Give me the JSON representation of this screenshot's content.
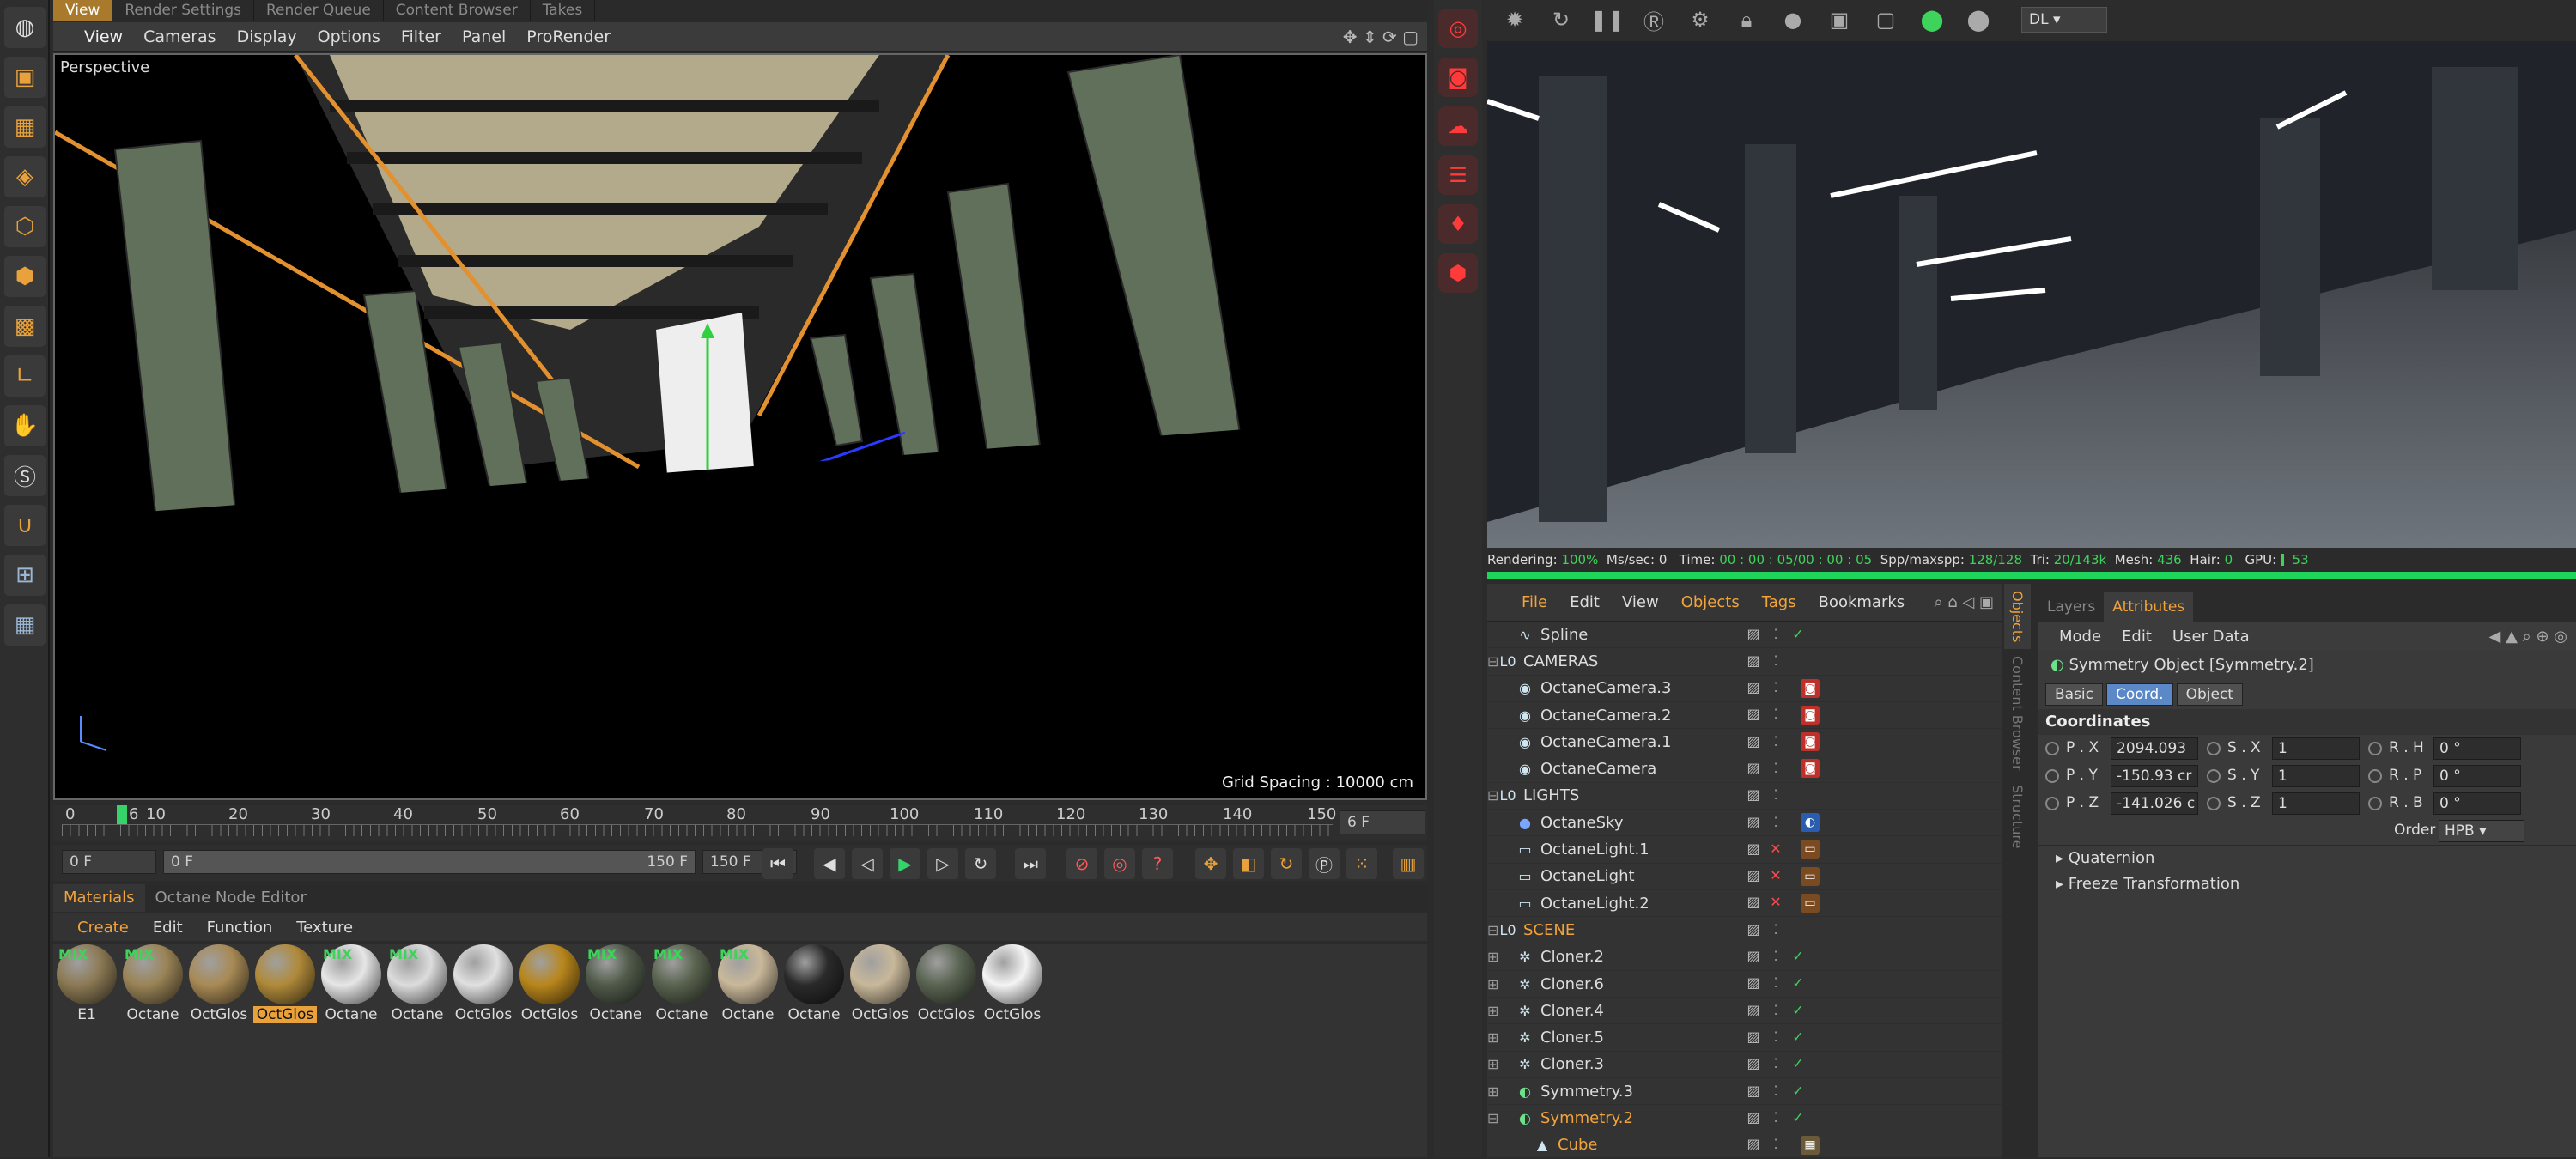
{
  "top_tabs": [
    "View",
    "Render Settings",
    "Render Queue",
    "Content Browser",
    "Takes"
  ],
  "viewport_menu": [
    "View",
    "Cameras",
    "Display",
    "Options",
    "Filter",
    "Panel",
    "ProRender"
  ],
  "viewport": {
    "label": "Perspective",
    "grid_spacing": "Grid Spacing : 10000 cm"
  },
  "timeline": {
    "ticks": [
      "0",
      "6",
      "10",
      "20",
      "30",
      "40",
      "50",
      "60",
      "70",
      "80",
      "90",
      "100",
      "110",
      "120",
      "130",
      "140",
      "150"
    ],
    "current_frame": "6 F",
    "start_field": "0 F",
    "range_start": "0 F",
    "range_end": "150 F",
    "end_field": "150 F"
  },
  "materials": {
    "tabs": [
      "Materials",
      "Octane Node Editor"
    ],
    "menu": [
      "Create",
      "Edit",
      "Function",
      "Texture"
    ],
    "items": [
      {
        "label": "E1",
        "mix": true,
        "color": "#8c7a55"
      },
      {
        "label": "Octane",
        "mix": true,
        "color": "#9a8457"
      },
      {
        "label": "OctGlos",
        "mix": false,
        "color": "#a88a55"
      },
      {
        "label": "OctGlos",
        "mix": false,
        "color": "#b08a3a",
        "selected": true
      },
      {
        "label": "Octane",
        "mix": true,
        "color": "#e6e6e6"
      },
      {
        "label": "Octane",
        "mix": true,
        "color": "#dcdcdc"
      },
      {
        "label": "OctGlos",
        "mix": false,
        "color": "#e0e0e0"
      },
      {
        "label": "OctGlos",
        "mix": false,
        "color": "#b8861c"
      },
      {
        "label": "Octane",
        "mix": true,
        "color": "#505a4a"
      },
      {
        "label": "Octane",
        "mix": true,
        "color": "#59634f"
      },
      {
        "label": "Octane",
        "mix": true,
        "color": "#c9b89a"
      },
      {
        "label": "Octane",
        "mix": false,
        "color": "#2a2a2a"
      },
      {
        "label": "OctGlos",
        "mix": false,
        "color": "#c8b89a"
      },
      {
        "label": "OctGlos",
        "mix": false,
        "color": "#5a6452"
      },
      {
        "label": "OctGlos",
        "mix": false,
        "color": "#f4f4f4"
      }
    ]
  },
  "render_toolbar": {
    "render_mode": "DL"
  },
  "render_stats": {
    "rendering_label": "Rendering:",
    "rendering": "100%",
    "ms_label": "Ms/sec:",
    "ms": "0",
    "time_label": "Time:",
    "time": "00 : 00 : 05/00 : 00 : 05",
    "spp_label": "Spp/maxspp:",
    "spp": "128/128",
    "tri_label": "Tri:",
    "tri": "20/143k",
    "mesh_label": "Mesh:",
    "mesh": "436",
    "hair_label": "Hair:",
    "hair": "0",
    "gpu_label": "GPU:",
    "gpu": "53"
  },
  "object_manager": {
    "menu": [
      "File",
      "Edit",
      "View",
      "Objects",
      "Tags",
      "Bookmarks"
    ],
    "rows": [
      {
        "name": "Spline",
        "level": 1,
        "icon": "spline-icon",
        "glyph": "∿",
        "check": true
      },
      {
        "name": "CAMERAS",
        "level": 0,
        "icon": "null-icon",
        "glyph": "L0",
        "expand": "⊟"
      },
      {
        "name": "OctaneCamera.3",
        "level": 1,
        "icon": "camera-icon",
        "glyph": "◉",
        "tags": [
          "cam"
        ]
      },
      {
        "name": "OctaneCamera.2",
        "level": 1,
        "icon": "camera-icon",
        "glyph": "◉",
        "tags": [
          "cam"
        ]
      },
      {
        "name": "OctaneCamera.1",
        "level": 1,
        "icon": "camera-icon",
        "glyph": "◉",
        "tags": [
          "cam"
        ]
      },
      {
        "name": "OctaneCamera",
        "level": 1,
        "icon": "camera-icon",
        "glyph": "◉",
        "tags": [
          "cam"
        ]
      },
      {
        "name": "LIGHTS",
        "level": 0,
        "icon": "null-icon",
        "glyph": "L0",
        "expand": "⊟"
      },
      {
        "name": "OctaneSky",
        "level": 1,
        "icon": "sky-icon",
        "glyph": "●",
        "tags": [
          "sky"
        ]
      },
      {
        "name": "OctaneLight.1",
        "level": 1,
        "icon": "light-icon",
        "glyph": "▭",
        "cross": true,
        "tags": [
          "light"
        ]
      },
      {
        "name": "OctaneLight",
        "level": 1,
        "icon": "light-icon",
        "glyph": "▭",
        "cross": true,
        "tags": [
          "light"
        ]
      },
      {
        "name": "OctaneLight.2",
        "level": 1,
        "icon": "light-icon",
        "glyph": "▭",
        "cross": true,
        "tags": [
          "light"
        ]
      },
      {
        "name": "SCENE",
        "level": 0,
        "icon": "null-icon",
        "glyph": "L0",
        "expand": "⊟",
        "highlight": true
      },
      {
        "name": "Cloner.2",
        "level": 1,
        "icon": "cloner-icon",
        "glyph": "✲",
        "expand": "⊞",
        "check": true
      },
      {
        "name": "Cloner.6",
        "level": 1,
        "icon": "cloner-icon",
        "glyph": "✲",
        "expand": "⊞",
        "check": true
      },
      {
        "name": "Cloner.4",
        "level": 1,
        "icon": "cloner-icon",
        "glyph": "✲",
        "expand": "⊞",
        "check": true
      },
      {
        "name": "Cloner.5",
        "level": 1,
        "icon": "cloner-icon",
        "glyph": "✲",
        "expand": "⊞",
        "check": true
      },
      {
        "name": "Cloner.3",
        "level": 1,
        "icon": "cloner-icon",
        "glyph": "✲",
        "expand": "⊞",
        "check": true
      },
      {
        "name": "Symmetry.3",
        "level": 1,
        "icon": "symmetry-icon",
        "glyph": "◐",
        "expand": "⊞",
        "check": true
      },
      {
        "name": "Symmetry.2",
        "level": 1,
        "icon": "symmetry-icon",
        "glyph": "◐",
        "expand": "⊟",
        "check": true,
        "highlight": true
      },
      {
        "name": "Cube",
        "level": 2,
        "icon": "cube-icon",
        "glyph": "▲",
        "highlight": true,
        "tags": [
          "mat"
        ]
      }
    ]
  },
  "side_tabs": [
    "Objects",
    "Content Browser",
    "Structure"
  ],
  "attributes": {
    "tabs": [
      "Layers",
      "Attributes"
    ],
    "menu": [
      "Mode",
      "Edit",
      "User Data"
    ],
    "title": "Symmetry Object [Symmetry.2]",
    "subtabs": [
      "Basic",
      "Coord.",
      "Object"
    ],
    "section": "Coordinates",
    "rows": [
      {
        "p_label": "P . X",
        "p_val": "2094.093",
        "s_label": "S . X",
        "s_val": "1",
        "r_label": "R . H",
        "r_val": "0 °"
      },
      {
        "p_label": "P . Y",
        "p_val": "-150.93 cr",
        "s_label": "S . Y",
        "s_val": "1",
        "r_label": "R . P",
        "r_val": "0 °"
      },
      {
        "p_label": "P . Z",
        "p_val": "-141.026 c",
        "s_label": "S . Z",
        "s_val": "1",
        "r_label": "R . B",
        "r_val": "0 °"
      }
    ],
    "order_label": "Order",
    "order_value": "HPB",
    "collapsed": [
      "Quaternion",
      "Freeze Transformation"
    ]
  },
  "colors": {
    "accent": "#f2a33a",
    "octane_red": "#ff3a3a",
    "progress": "#1fd45a"
  }
}
